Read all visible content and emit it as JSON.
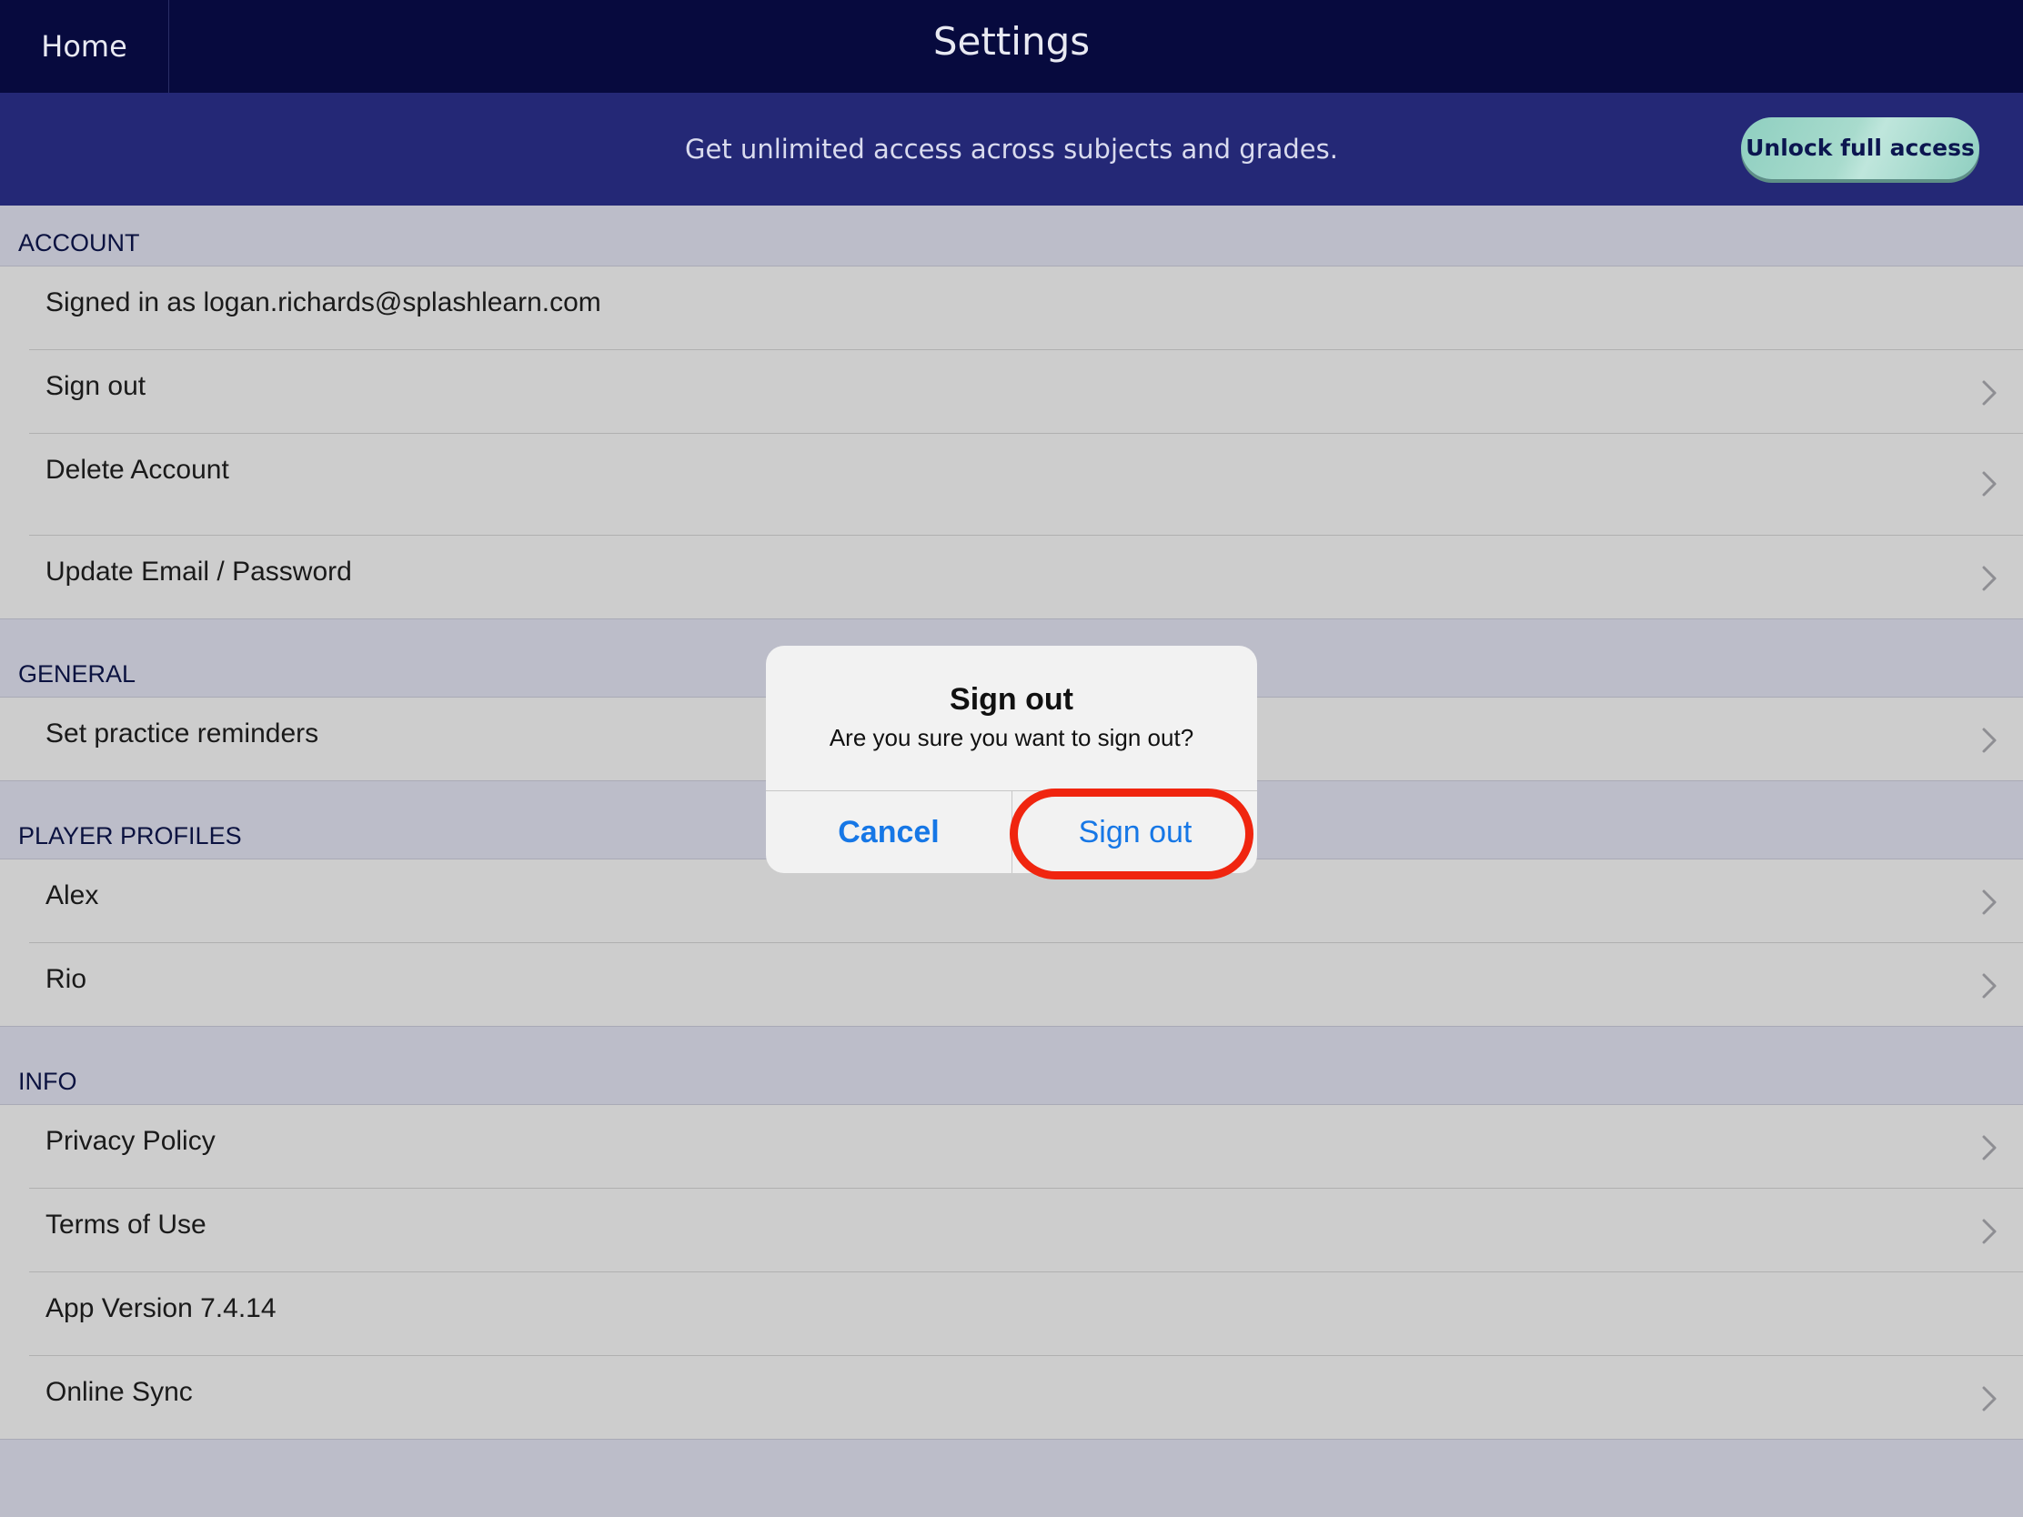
{
  "header": {
    "home_label": "Home",
    "title": "Settings"
  },
  "banner": {
    "text": "Get unlimited access across subjects and grades.",
    "cta_label": "Unlock full access"
  },
  "sections": {
    "account": {
      "title": "ACCOUNT",
      "rows": [
        "Signed in as logan.richards@splashlearn.com",
        "Sign out",
        "Delete Account",
        "Update Email / Password"
      ]
    },
    "general": {
      "title": "GENERAL",
      "rows": [
        "Set practice reminders"
      ]
    },
    "player_profiles": {
      "title": "PLAYER PROFILES",
      "rows": [
        "Alex",
        "Rio"
      ]
    },
    "info": {
      "title": "INFO",
      "rows": [
        "Privacy Policy",
        "Terms of Use",
        "App Version 7.4.14",
        "Online Sync"
      ]
    }
  },
  "dialog": {
    "title": "Sign out",
    "message": "Are you sure you want to sign out?",
    "cancel_label": "Cancel",
    "confirm_label": "Sign out"
  },
  "colors": {
    "topbar": "#070a3e",
    "banner": "#242876",
    "accent_button": "#8fcfc0",
    "link_blue": "#1677e6",
    "highlight_red": "#f0250f"
  },
  "icons": {
    "row_chevron": "chevron-right-icon"
  }
}
